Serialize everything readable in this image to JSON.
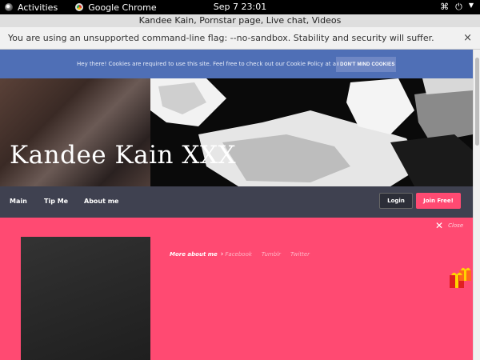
{
  "system_bar": {
    "activities": "Activities",
    "app_name": "Google Chrome",
    "clock": "Sep 7  23:01"
  },
  "browser": {
    "window_title": "Kandee Kain, Pornstar page, Live chat, Videos",
    "warning": "You are using an unsupported command-line flag: --no-sandbox. Stability and security will suffer.",
    "warning_close": "×"
  },
  "cookie_banner": {
    "text": "Hey there! Cookies are required to use this site. Feel free to check out our Cookie Policy at any time.",
    "button": "I DON'T MIND COOKIES"
  },
  "hero": {
    "title": "Kandee Kain XXX"
  },
  "nav": {
    "items": [
      "Main",
      "Tip Me",
      "About me"
    ],
    "login": "Login",
    "join": "Join Free!"
  },
  "profile": {
    "close_label": "Close",
    "more_about": "More about me",
    "socials": [
      "Facebook",
      "Tumblr",
      "Twitter"
    ]
  },
  "colors": {
    "accent_pink": "#ff4a72",
    "navbar": "#3f4150",
    "cookie_bar": "#4f6fb6"
  }
}
